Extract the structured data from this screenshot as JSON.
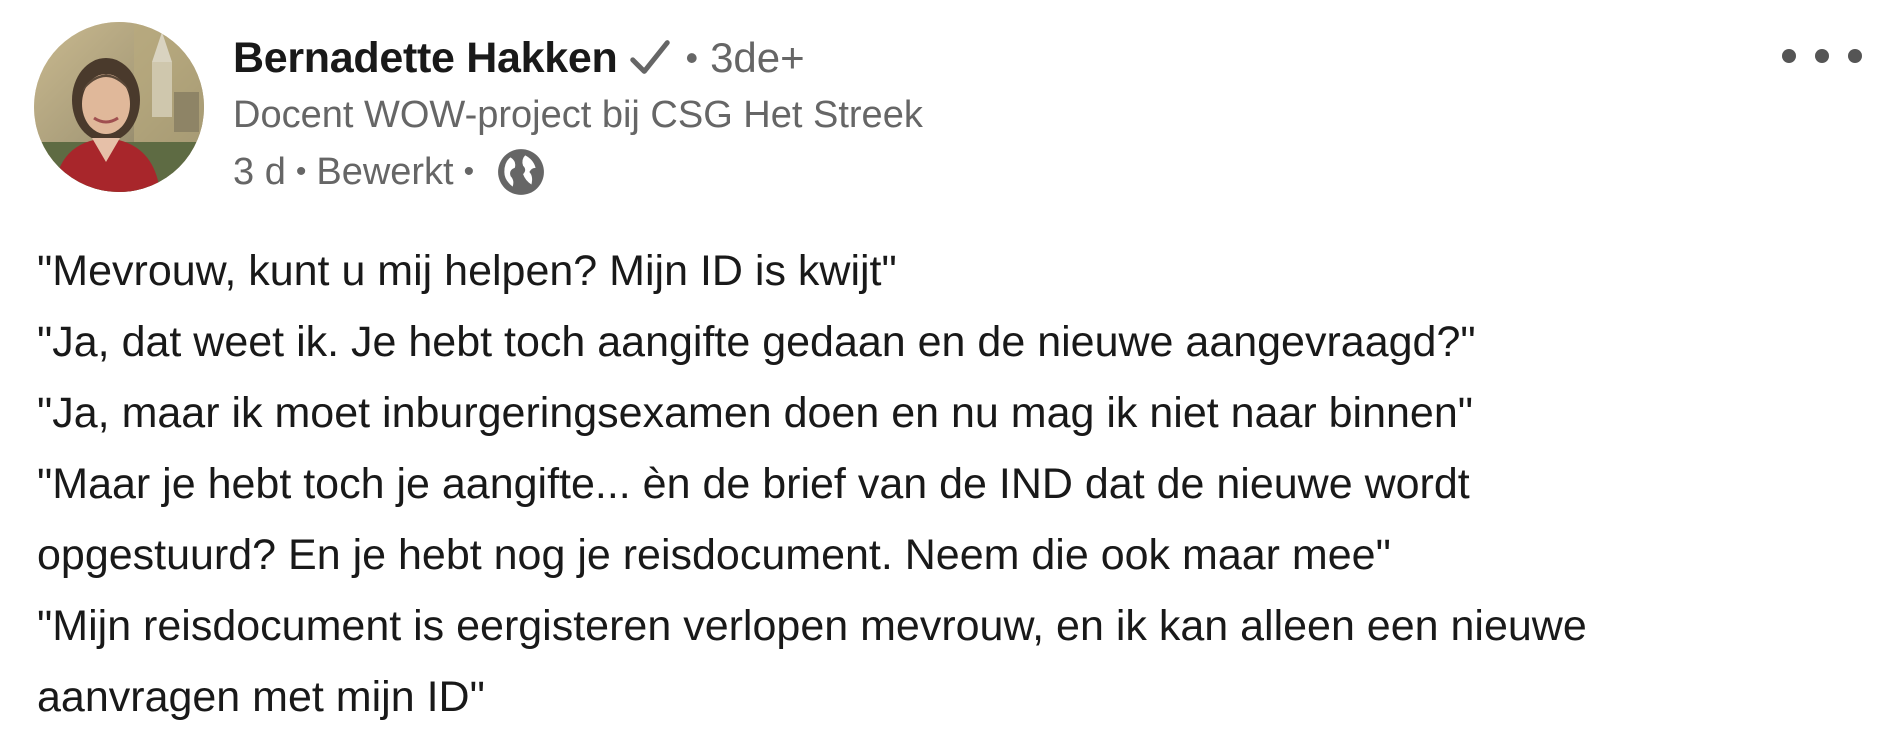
{
  "author": {
    "name": "Bernadette Hakken",
    "verified_glyph": "✓",
    "degree_separator": "•",
    "degree": "3de+",
    "headline": "Docent WOW-project bij CSG Het Streek",
    "time": "3 d",
    "time_separator": "•",
    "edited": "Bewerkt",
    "edited_separator": "•",
    "visibility_icon": "globe-icon"
  },
  "actions": {
    "more_icon": "more-horizontal-icon"
  },
  "post": {
    "lines": [
      "\"Mevrouw, kunt u mij helpen? Mijn ID is kwijt\"",
      "\"Ja, dat weet ik. Je hebt toch aangifte gedaan en de nieuwe aangevraagd?\"",
      "\"Ja, maar ik moet inburgeringsexamen doen en nu mag ik niet naar binnen\"",
      "\"Maar je hebt toch je aangifte... èn de brief van de IND dat de nieuwe wordt",
      "opgestuurd? En je hebt nog je reisdocument. Neem die ook maar mee\"",
      "\"Mijn reisdocument is eergisteren verlopen mevrouw, en ik kan alleen een nieuwe",
      "aanvragen met mijn ID\""
    ]
  },
  "colors": {
    "text_primary": "#191919",
    "text_secondary": "#666666",
    "background": "#ffffff"
  }
}
